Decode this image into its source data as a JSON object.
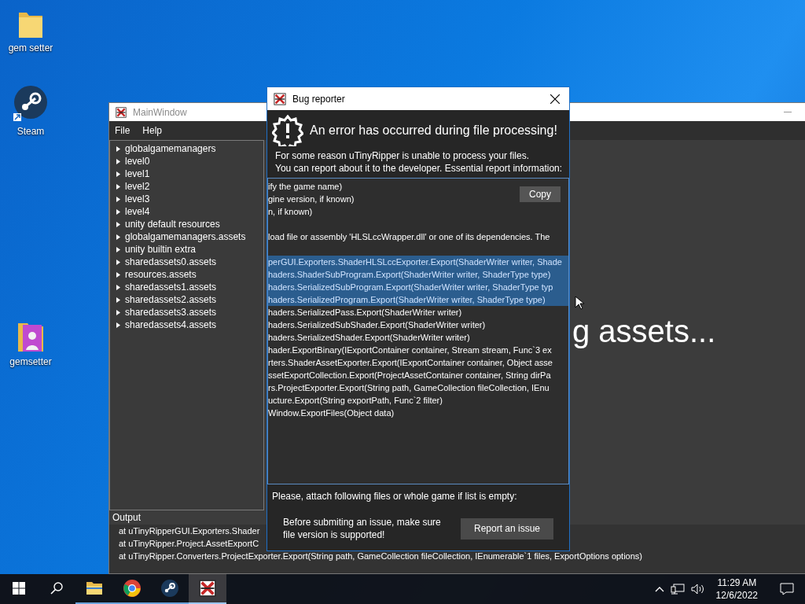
{
  "desktop_icons": [
    {
      "label": "gem setter",
      "kind": "folder"
    },
    {
      "label": "Steam",
      "kind": "steam"
    },
    {
      "label": "gemsetter",
      "kind": "app"
    }
  ],
  "main_window": {
    "title": "MainWindow",
    "menu": [
      "File",
      "Help"
    ],
    "tree": [
      {
        "label": "globalgamemanagers",
        "expanded": false
      },
      {
        "label": "level0",
        "expanded": false
      },
      {
        "label": "level1",
        "expanded": false
      },
      {
        "label": "level2",
        "expanded": false
      },
      {
        "label": "level3",
        "expanded": false
      },
      {
        "label": "level4",
        "expanded": false
      },
      {
        "label": "unity default resources",
        "expanded": false
      },
      {
        "label": "globalgamemanagers.assets",
        "expanded": false
      },
      {
        "label": "unity builtin extra",
        "expanded": false
      },
      {
        "label": "sharedassets0.assets",
        "expanded": false
      },
      {
        "label": "resources.assets",
        "expanded": false
      },
      {
        "label": "sharedassets1.assets",
        "expanded": false
      },
      {
        "label": "sharedassets2.assets",
        "expanded": false
      },
      {
        "label": "sharedassets3.assets",
        "expanded": false
      },
      {
        "label": "sharedassets4.assets",
        "expanded": false
      }
    ],
    "status_text": "g assets...",
    "output": {
      "title": "Output",
      "lines": [
        "at uTinyRipperGUI.Exporters.Shader",
        "at uTinyRipper.Project.AssetExportC",
        "at uTinyRipper.Converters.ProjectExporter.Export(String path, GameCollection fileCollection, IEnumerable`1 files, ExportOptions options)"
      ]
    }
  },
  "dialog": {
    "title": "Bug reporter",
    "heading": "An error has occurred during file processing!",
    "message_lines": [
      "For some reason uTinyRipper is unable to process your files.",
      "You can report about it to the developer. Essential report information:"
    ],
    "report": {
      "copy_button": "Copy",
      "lines": [
        {
          "text": "ify the game name)",
          "selected": false
        },
        {
          "text": "gine version, if known)",
          "selected": false
        },
        {
          "text": "n, if known)",
          "selected": false
        },
        {
          "selected": false
        },
        {
          "text": "load file or assembly 'HLSLccWrapper.dll' or one of its dependencies. The",
          "selected": false
        },
        {
          "selected": false
        },
        {
          "text": "perGUI.Exporters.ShaderHLSLccExporter.Export(ShaderWriter writer, Shade",
          "selected": true
        },
        {
          "text": "haders.ShaderSubProgram.Export(ShaderWriter writer, ShaderType type)",
          "selected": true
        },
        {
          "text": "haders.SerializedSubProgram.Export(ShaderWriter writer, ShaderType typ",
          "selected": true
        },
        {
          "text": "haders.SerializedProgram.Export(ShaderWriter writer, ShaderType type)",
          "selected": true
        },
        {
          "text": "haders.SerializedPass.Export(ShaderWriter writer)",
          "selected": false
        },
        {
          "text": "haders.SerializedSubShader.Export(ShaderWriter writer)",
          "selected": false
        },
        {
          "text": "haders.SerializedShader.Export(ShaderWriter writer)",
          "selected": false
        },
        {
          "text": "hader.ExportBinary(IExportContainer container, Stream stream, Func`3 ex",
          "selected": false
        },
        {
          "text": "rters.ShaderAssetExporter.Export(IExportContainer container, Object asse",
          "selected": false
        },
        {
          "text": "ssetExportCollection.Export(ProjectAssetContainer container, String dirPa",
          "selected": false
        },
        {
          "text": "rs.ProjectExporter.Export(String path, GameCollection fileCollection, IEnu",
          "selected": false
        },
        {
          "text": "ucture.Export(String exportPath, Func`2 filter)",
          "selected": false
        },
        {
          "text": "Window.ExportFiles(Object data)",
          "selected": false
        }
      ]
    },
    "attach_label": "Please, attach following files or whole game if list is empty:",
    "note_lines": [
      "Before submiting an issue, make sure",
      "file version is supported!"
    ],
    "report_button": "Report an issue"
  },
  "taskbar": {
    "apps": [
      {
        "kind": "explorer",
        "running": true,
        "selected": false
      },
      {
        "kind": "chrome",
        "running": true,
        "selected": false
      },
      {
        "kind": "steam",
        "running": true,
        "selected": false
      },
      {
        "kind": "ripper",
        "running": true,
        "selected": true
      }
    ],
    "time": "11:29 AM",
    "date": "12/6/2022"
  }
}
